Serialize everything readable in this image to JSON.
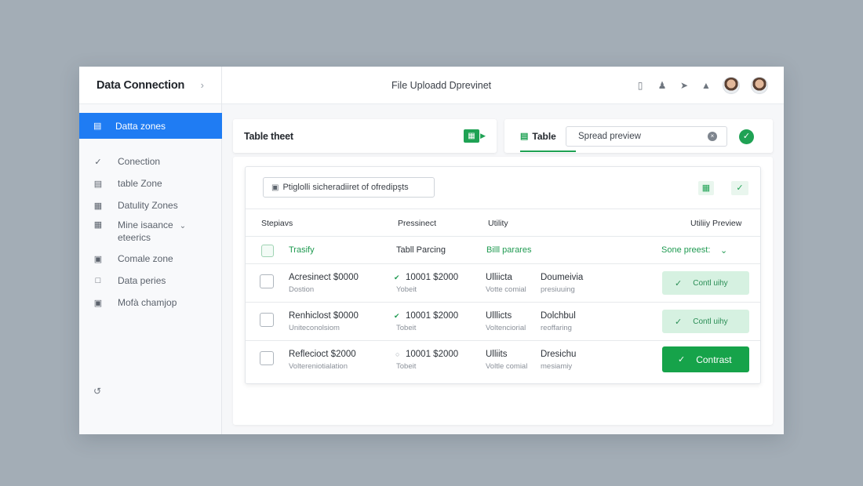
{
  "sidebar": {
    "title": "Data Connection",
    "active": "Datta zones",
    "items": [
      {
        "label": "Conection",
        "icon": "check-mark-icon"
      },
      {
        "label": "table Zone",
        "icon": "table-icon"
      },
      {
        "label": "Datulity Zones",
        "icon": "grid-icon"
      },
      {
        "label_line1": "Mine isaance",
        "label_line2": "eteerics",
        "icon": "calendar-icon"
      },
      {
        "label": "Comale zone",
        "icon": "image-icon"
      },
      {
        "label": "Data peries",
        "icon": "folder-icon"
      },
      {
        "label": "Mofà chamjop",
        "icon": "picture-icon"
      }
    ]
  },
  "header": {
    "title": "File Uploadd Dprevinet"
  },
  "table_sheet": {
    "label": "Table theet"
  },
  "tab": {
    "label": "Table"
  },
  "search": {
    "value": "Spread preview"
  },
  "filter_chip": {
    "label": "Ptiglolli sicheradiiret of ofredipşts"
  },
  "table": {
    "headers": [
      "Stepiavs",
      "Pressinect",
      "Utility",
      "Utiliiy Preview"
    ],
    "subheader": {
      "col1": "Trasify",
      "col2": "Tabll Parcing",
      "col3": "Billl parares",
      "col4": "Sone preest:"
    },
    "rows": [
      {
        "c1a": "Acresinect $0000",
        "c1b": "Dostion",
        "c2a": "10001 $2000",
        "c2b": "Yobeit",
        "c3a": "Ulliicta",
        "c3b": "Votte comial",
        "c4a": "Doumeivia",
        "c4b": "presiuuing",
        "action": "Contl uihy"
      },
      {
        "c1a": "Renhiclost $0000",
        "c1b": "Uniteconolsiom",
        "c2a": "10001 $2000",
        "c2b": "Tobeit",
        "c3a": "Ulllicts",
        "c3b": "Voltenciorial",
        "c4a": "Dolchbul",
        "c4b": "reoffaring",
        "action": "Contl uihy"
      },
      {
        "c1a": "Reflecioct $2000",
        "c1b": "Voltereniotialation",
        "c2a": "10001 $2000",
        "c2b": "Tobeit",
        "c3a": "Ulliits",
        "c3b": "Voltle comial",
        "c4a": "Dresichu",
        "c4b": "mesiamiy",
        "action": "Contrast"
      }
    ]
  },
  "colors": {
    "accent": "#1f7cf3",
    "success": "#16a34a"
  }
}
